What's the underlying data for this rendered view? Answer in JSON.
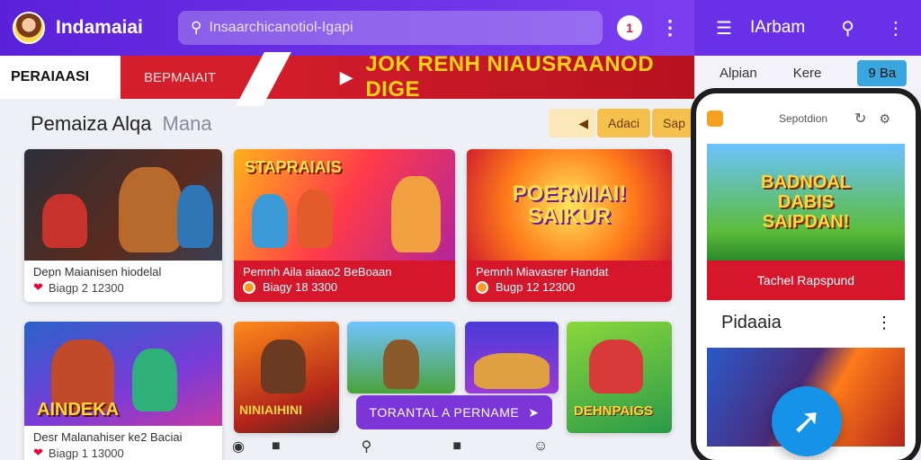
{
  "header": {
    "app_name": "Indamaiai",
    "search_placeholder": "Insaarchicanotiol-Igapi",
    "notif_badge": "1"
  },
  "banner": {
    "tab1": "PERAIAASI",
    "tab2": "BEPMAIAIT",
    "headline": "JOK RENH NIAUSRAANOD DIGE"
  },
  "section": {
    "title": "Pemaiza Alqa",
    "subtitle": "Mana",
    "pill1": "Adaci",
    "pill2": "Sap"
  },
  "cards": [
    {
      "title": "Depn Maianisen hiodelal",
      "meta": "Biagp 2 12300",
      "art": ""
    },
    {
      "title": "Pemnh Aila aiaao2 BeBoaan",
      "meta": "Biagy 18 3300",
      "art": "STAPRAIAIS"
    },
    {
      "title": "Pemnh Miavasrer Handat",
      "meta": "Bugp 12 12300",
      "art": "POERMIAI! SAIKUR"
    },
    {
      "title": "Desr Malanahiser ke2 Baciai",
      "meta": "Biagp 1 13000",
      "art": "AINDEKA"
    }
  ],
  "row2": {
    "art2": "NINIAIHINI",
    "art4": "DEHNPAIGS"
  },
  "cta": {
    "label": "TORANTAL A PERNAME"
  },
  "phone": {
    "title": "IArbam",
    "tab_a": "Alpian",
    "tab_b": "Kere",
    "tab_c": "9 Ba",
    "screen_header": "Sepotdion",
    "game_art": "BADNOAL DABIS SAIPDAN!",
    "game_btn": "Tachel Rapspund",
    "list_title": "Pidaaia"
  },
  "colors": {
    "primary": "#6a30e8",
    "accent": "#d51d2b",
    "fab": "#1593e8"
  }
}
